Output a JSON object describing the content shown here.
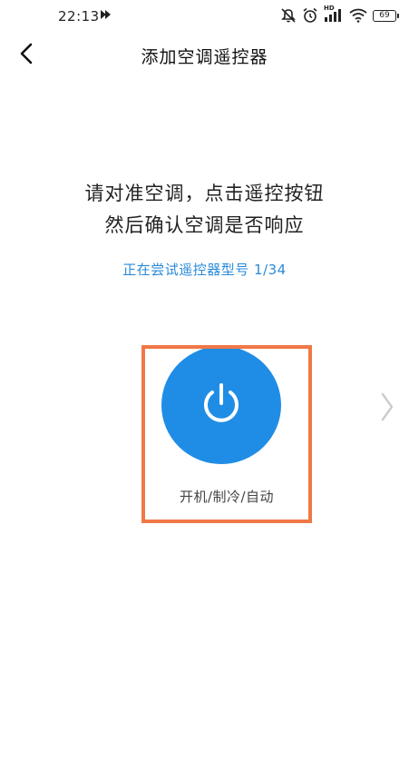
{
  "status_bar": {
    "time": "22:13",
    "battery": "69",
    "network_label": "HD"
  },
  "header": {
    "title": "添加空调遥控器"
  },
  "instruction": {
    "line1": "请对准空调，点击遥控按钮",
    "line2": "然后确认空调是否响应"
  },
  "progress": {
    "text": "正在尝试遥控器型号 1/34"
  },
  "remote": {
    "power_label": "开机/制冷/自动"
  },
  "colors": {
    "accent_blue": "#1f8de6",
    "progress_blue": "#2a8ad8",
    "highlight_orange": "#f07847"
  },
  "icons": {
    "back": "chevron-left-icon",
    "next": "chevron-right-icon",
    "power": "power-icon"
  }
}
